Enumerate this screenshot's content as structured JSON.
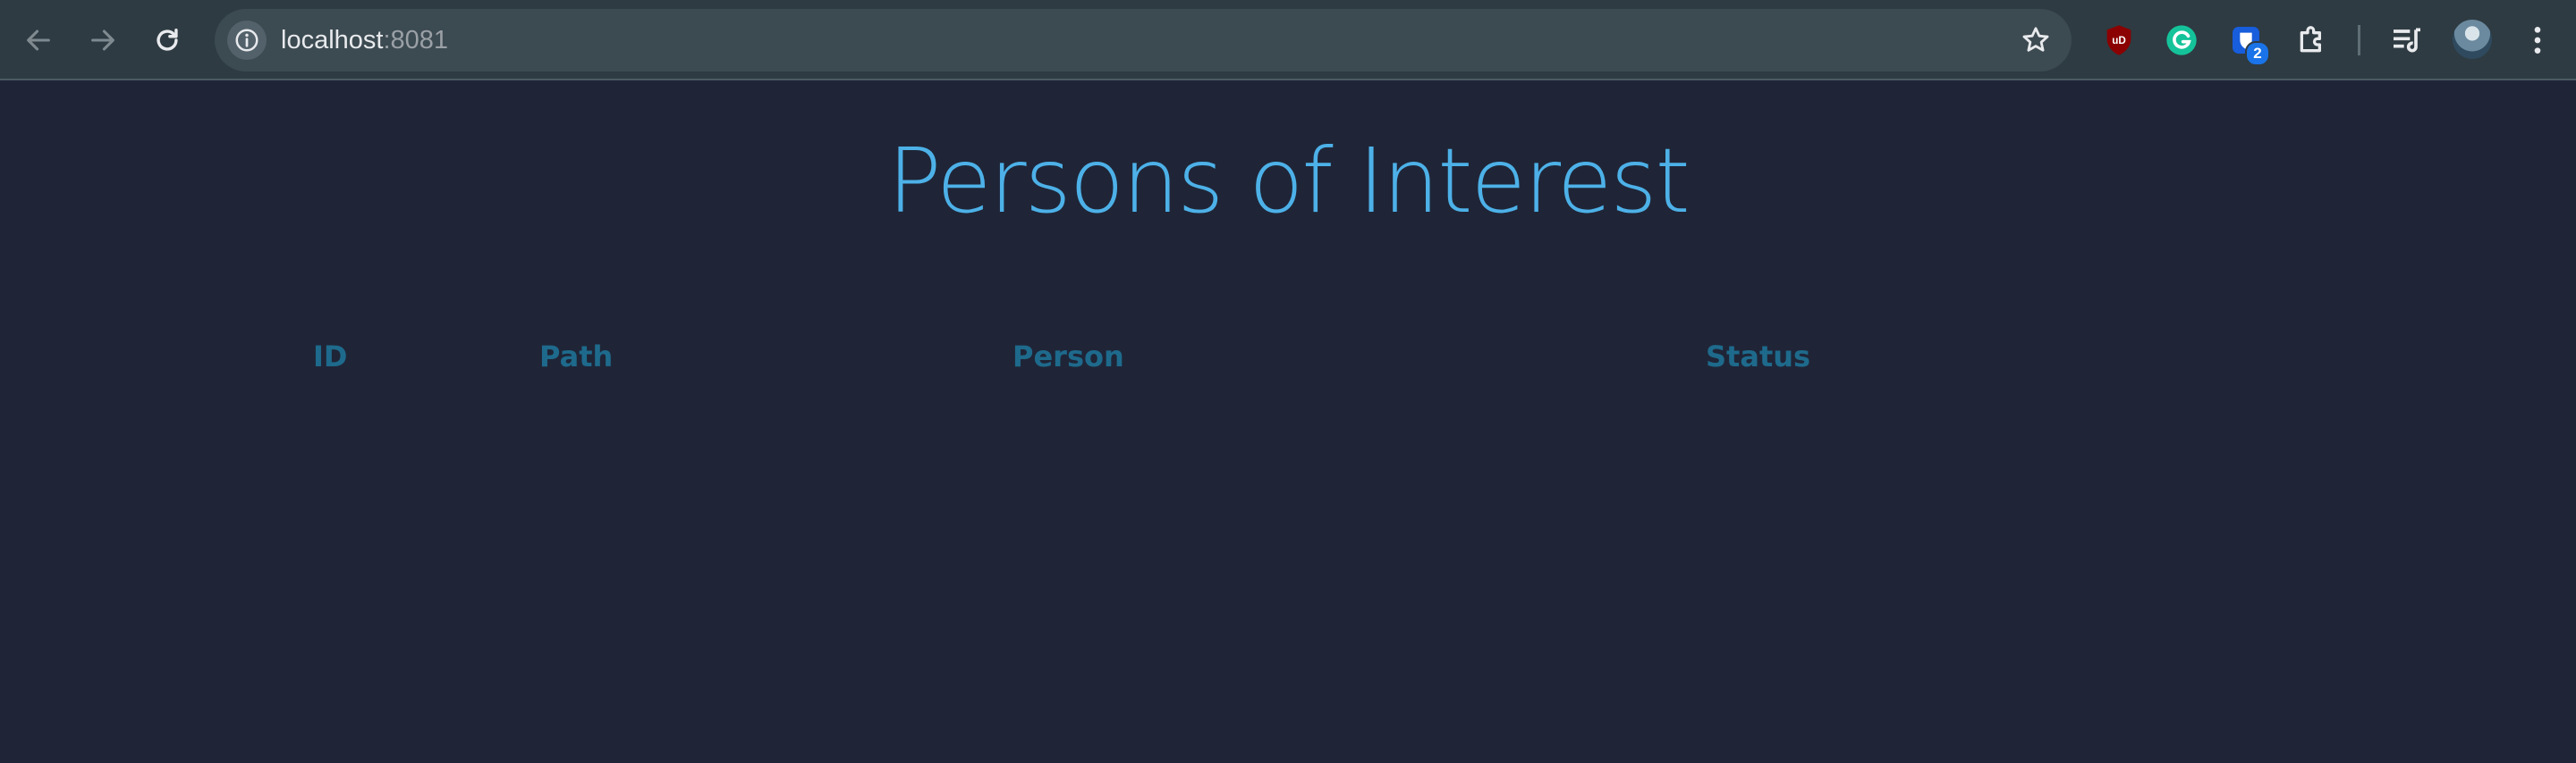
{
  "browser": {
    "url_host": "localhost",
    "url_port": ":8081",
    "extensions": [
      {
        "name": "ublock-origin",
        "label": "uD",
        "color": "#8b0000"
      },
      {
        "name": "grammarly",
        "label": "G",
        "color": "#15c39a"
      },
      {
        "name": "bitwarden",
        "label": "",
        "color": "#175ddc",
        "badge": "2"
      },
      {
        "name": "extensions",
        "label": "",
        "color": "#e8eaed"
      }
    ],
    "icons": [
      "back-arrow-icon",
      "forward-arrow-icon",
      "reload-icon",
      "info-icon",
      "star-icon",
      "puzzle-icon",
      "media-playlist-icon",
      "kebab-menu-icon"
    ]
  },
  "page": {
    "title": "Persons of Interest",
    "table": {
      "columns": [
        "ID",
        "Path",
        "Person",
        "Status"
      ],
      "rows": []
    }
  },
  "colors": {
    "page_background": "#1f2537",
    "title": "#4db1e8",
    "column_header": "#1e6a8c",
    "toolbar": "#2e3b42"
  }
}
